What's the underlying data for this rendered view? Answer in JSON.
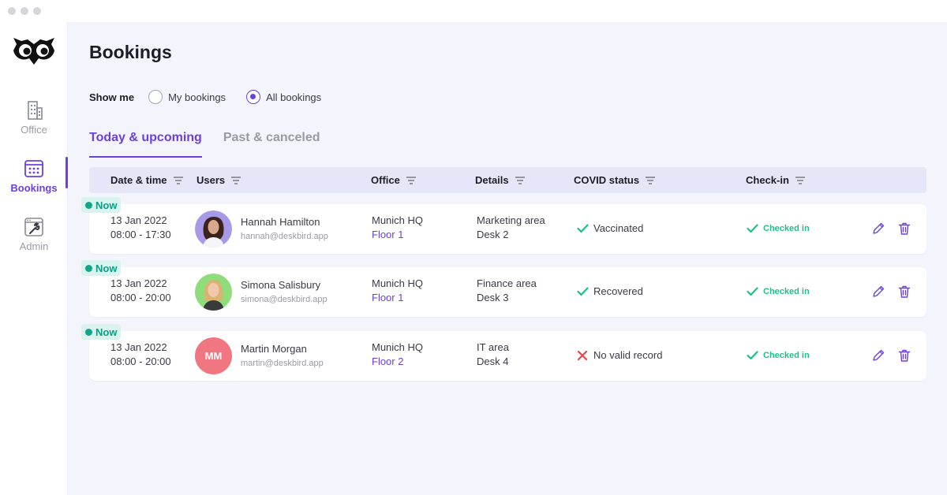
{
  "sidebar": {
    "items": [
      {
        "label": "Office",
        "icon": "building-icon"
      },
      {
        "label": "Bookings",
        "icon": "calendar-icon",
        "active": true
      },
      {
        "label": "Admin",
        "icon": "admin-tools-icon"
      }
    ]
  },
  "page": {
    "title": "Bookings"
  },
  "filter": {
    "label": "Show me",
    "options": [
      {
        "label": "My bookings",
        "selected": false
      },
      {
        "label": "All bookings",
        "selected": true
      }
    ]
  },
  "tabs": [
    {
      "label": "Today & upcoming",
      "active": true
    },
    {
      "label": "Past & canceled",
      "active": false
    }
  ],
  "table": {
    "columns": [
      "Date & time",
      "Users",
      "Office",
      "Details",
      "COVID status",
      "Check-in"
    ],
    "rows": [
      {
        "badge": "Now",
        "date": "13 Jan 2022",
        "time": "08:00 - 17:30",
        "user": {
          "name": "Hannah Hamilton",
          "email": "hannah@deskbird.app",
          "avatar": "photo"
        },
        "office": "Munich HQ",
        "floor": "Floor 1",
        "area": "Marketing area",
        "desk": "Desk 2",
        "covid": {
          "text": "Vaccinated",
          "icon": "check-icon"
        },
        "checkin": "Checked in"
      },
      {
        "badge": "Now",
        "date": "13 Jan 2022",
        "time": "08:00 - 20:00",
        "user": {
          "name": "Simona Salisbury",
          "email": "simona@deskbird.app",
          "avatar": "photo"
        },
        "office": "Munich HQ",
        "floor": "Floor 1",
        "area": "Finance area",
        "desk": "Desk 3",
        "covid": {
          "text": "Recovered",
          "icon": "check-icon"
        },
        "checkin": "Checked in"
      },
      {
        "badge": "Now",
        "date": "13 Jan 2022",
        "time": "08:00 - 20:00",
        "user": {
          "name": "Martin Morgan",
          "email": "martin@deskbird.app",
          "avatar": "initials",
          "initials": "MM"
        },
        "office": "Munich HQ",
        "floor": "Floor 2",
        "area": "IT area",
        "desk": "Desk 4",
        "covid": {
          "text": "No valid record",
          "icon": "cross-icon"
        },
        "checkin": "Checked in"
      }
    ]
  },
  "colors": {
    "accent": "#6b3fe0",
    "success": "#1fbf87",
    "danger": "#e5484d",
    "badge_bg": "#d9f3ee",
    "badge_text": "#119c84",
    "avatar_initials_bg": "#f07781"
  }
}
